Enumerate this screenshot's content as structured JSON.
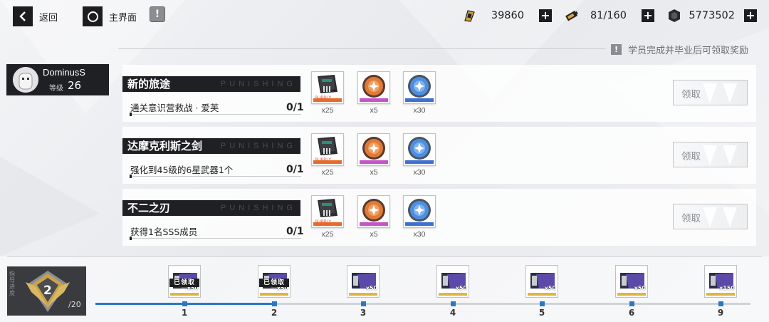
{
  "topbar": {
    "back_label": "返回",
    "home_label": "主界面",
    "info_glyph": "!",
    "resources": [
      {
        "icon": "gold-ticket-icon",
        "value": "39860"
      },
      {
        "icon": "stamina-battery-icon",
        "value": "81/160"
      },
      {
        "icon": "coin-icon",
        "value": "5773502"
      }
    ]
  },
  "notice": {
    "glyph": "!",
    "text": "学员完成并毕业后可领取奖励"
  },
  "player": {
    "name": "DominusS",
    "level_label": "等级",
    "level": "26"
  },
  "watermark": "PUNISHING",
  "tasks": [
    {
      "title": "新的旅途",
      "desc": "通关意识营救战 · 爱芙",
      "progress": "0/1",
      "claim_label": "领取",
      "rewards": [
        {
          "icon": "supply-chip-icon",
          "qty": "x25",
          "rarity_color": "#e66a2c"
        },
        {
          "icon": "orange-coin-icon",
          "qty": "x5",
          "rarity_color": "#c455c8"
        },
        {
          "icon": "blue-coin-icon",
          "qty": "x30",
          "rarity_color": "#3f6fd1"
        }
      ]
    },
    {
      "title": "达摩克利斯之剑",
      "desc": "强化到45级的6星武器1个",
      "progress": "0/1",
      "claim_label": "领取",
      "rewards": [
        {
          "icon": "supply-chip-icon",
          "qty": "x25",
          "rarity_color": "#e66a2c"
        },
        {
          "icon": "orange-coin-icon",
          "qty": "x5",
          "rarity_color": "#c455c8"
        },
        {
          "icon": "blue-coin-icon",
          "qty": "x30",
          "rarity_color": "#3f6fd1"
        }
      ]
    },
    {
      "title": "不二之刃",
      "desc": "获得1名SSS成员",
      "progress": "0/1",
      "claim_label": "领取",
      "rewards": [
        {
          "icon": "supply-chip-icon",
          "qty": "x25",
          "rarity_color": "#e66a2c"
        },
        {
          "icon": "orange-coin-icon",
          "qty": "x5",
          "rarity_color": "#c455c8"
        },
        {
          "icon": "blue-coin-icon",
          "qty": "x30",
          "rarity_color": "#3f6fd1"
        }
      ]
    }
  ],
  "rank": {
    "vertical_label": "指导进度",
    "current": "2",
    "max": "/20"
  },
  "track": {
    "progress_fraction": 0.275,
    "claimed_label": "已领取",
    "nodes": [
      {
        "label": "1",
        "qty": "x50",
        "claimed": true
      },
      {
        "label": "2",
        "qty": "x50",
        "claimed": true
      },
      {
        "label": "3",
        "qty": "x50",
        "claimed": false
      },
      {
        "label": "4",
        "qty": "x50",
        "claimed": false
      },
      {
        "label": "5",
        "qty": "x50",
        "claimed": false
      },
      {
        "label": "6",
        "qty": "x50",
        "claimed": false
      },
      {
        "label": "9",
        "qty": "x150",
        "claimed": false
      }
    ]
  }
}
